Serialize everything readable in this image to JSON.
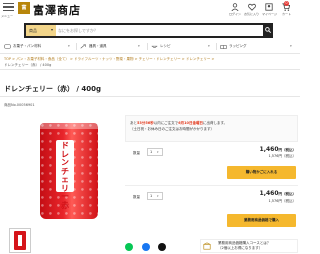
{
  "header": {
    "menu_label": "メニュー",
    "logo_mark": "富",
    "logo_text": "富澤商店",
    "icons": [
      {
        "name": "login-icon",
        "label": "ログイン"
      },
      {
        "name": "favorite-icon",
        "label": "お気に入り"
      },
      {
        "name": "mypage-icon",
        "label": "マイページ"
      },
      {
        "name": "cart-icon",
        "label": "カート"
      }
    ],
    "cart_count": "0"
  },
  "search": {
    "category": "商品",
    "placeholder": "なにをお探しですか？"
  },
  "categories": [
    {
      "icon": "ingredients-icon",
      "label": "お菓子・パン材料"
    },
    {
      "icon": "tools-icon",
      "label": "器具・道具"
    },
    {
      "icon": "recipe-icon",
      "label": "レシピ"
    },
    {
      "icon": "wrapping-icon",
      "label": "ラッピング"
    }
  ],
  "breadcrumb": {
    "items": [
      "TOP",
      "パン・お菓子材料・食品（全て）",
      "ドライフルーツ・ナッツ・野菜・果物",
      "チェリー・ドレンチェリー",
      "ドレンチェリー"
    ],
    "current": "ドレンチェリー（赤） / 400g"
  },
  "product": {
    "title": "ドレンチェリー（赤） / 400g",
    "number": "商品No.00056901",
    "bag_label": "ドレンチェリー赤"
  },
  "notice": {
    "line1_pre": "あと",
    "highlight1": "53分56秒",
    "line1_mid": "以内にご注文で",
    "highlight2": "6月10日",
    "highlight3": "金曜日",
    "line1_post": "に出荷します。",
    "line2": "（土日祝・お休み日のご注文はお時間がかかります）"
  },
  "purchase_rows": [
    {
      "qty_label": "数量",
      "qty": "1",
      "price": "1,460",
      "price_unit": "円（税込）",
      "price_ex": "1,576円（税込）",
      "button": "購い物かごに入れる"
    },
    {
      "qty_label": "数量",
      "qty": "1",
      "price": "1,460",
      "price_unit": "円（税込）",
      "price_ex": "1,576円（税込）",
      "button": "業務用商品価格で購入"
    }
  ],
  "package_notice": {
    "line1": "業務用商品価格購入コースとは？",
    "line2": "（2個以上お得になります）"
  },
  "share": [
    {
      "name": "line-icon",
      "color": "#06c755"
    },
    {
      "name": "facebook-icon",
      "color": "#1877f2"
    },
    {
      "name": "x-icon",
      "color": "#111111"
    }
  ],
  "colors": {
    "accent": "#f5b82e",
    "highlight": "#e33b1f",
    "brand": "#b8860b"
  }
}
